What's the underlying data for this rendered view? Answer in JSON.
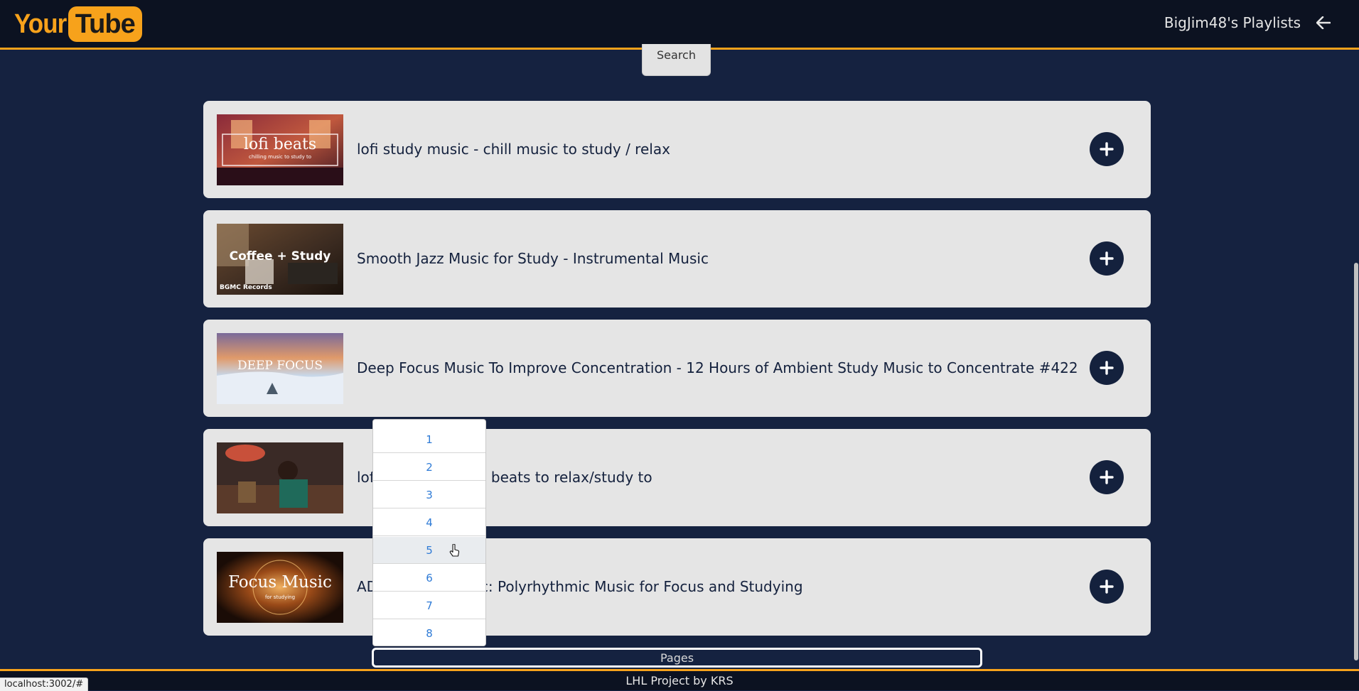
{
  "header": {
    "logo_left": "Your",
    "logo_right": "Tube",
    "title": "BigJim48's Playlists",
    "back_icon": "arrow-left-icon"
  },
  "search": {
    "label": "Search"
  },
  "videos": [
    {
      "title": "lofi study music - chill music to study / relax",
      "thumb_text": "lofi beats",
      "thumb_subtext": "chilling music to study to"
    },
    {
      "title": "Smooth Jazz Music for Study - Instrumental Music",
      "thumb_text": "Coffee + Study",
      "thumb_subtext": "BGMC Records"
    },
    {
      "title": "Deep Focus Music To Improve Concentration - 12 Hours of Ambient Study Music to Concentrate #422",
      "thumb_text": "DEEP FOCUS",
      "thumb_subtext": ""
    },
    {
      "title": "lofi hip hop radio - beats to relax/study to",
      "thumb_text": "",
      "thumb_subtext": ""
    },
    {
      "title": "ADHD Relief Music: Polyrhythmic Music for Focus and Studying",
      "thumb_text": "Focus Music",
      "thumb_subtext": "for studying"
    }
  ],
  "pagination": {
    "label": "Pages",
    "options": [
      "1",
      "2",
      "3",
      "4",
      "5",
      "6",
      "7",
      "8"
    ],
    "hovered": "5"
  },
  "footer": {
    "text": "LHL Project by KRS"
  },
  "status_url": "localhost:3002/#",
  "colors": {
    "accent": "#f7a21b",
    "navy": "#14213d",
    "background": "#152240",
    "card": "#e5e5e5",
    "link": "#2f7bd6"
  }
}
